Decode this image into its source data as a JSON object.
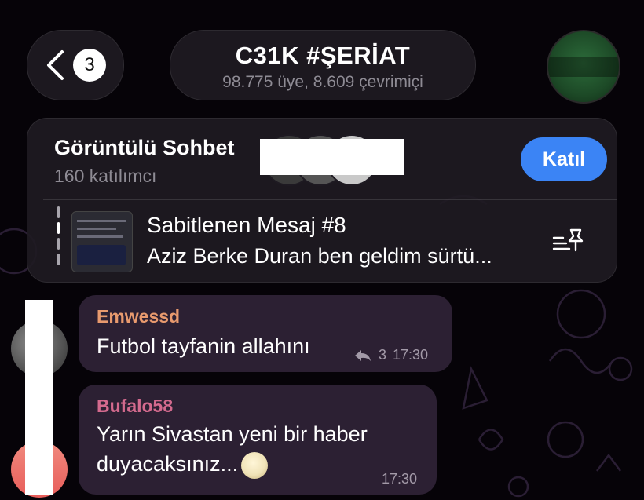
{
  "header": {
    "back_count": "3",
    "title": "C31K #ŞERİAT",
    "subtitle": "98.775 üye, 8.609 çevrimiçi"
  },
  "video_chat": {
    "title": "Görüntülü Sohbet",
    "participants": "160 katılımcı",
    "join_label": "Katıl"
  },
  "pinned": {
    "title": "Sabitlenen Mesaj #8",
    "text": "Aziz Berke Duran ben geldim sürtü..."
  },
  "messages": [
    {
      "sender": "Emwessd",
      "text": "Futbol tayfanin allahını",
      "reply_count": "3",
      "time": "17:30"
    },
    {
      "sender": "Bufalo58",
      "text": "Yarın Sivastan yeni bir haber duyacaksınız...",
      "time": "17:30"
    }
  ],
  "colors": {
    "accent": "#3b84f5",
    "bubble": "#2c2033",
    "sender1": "#e89a6e",
    "sender2": "#d46a8e"
  }
}
